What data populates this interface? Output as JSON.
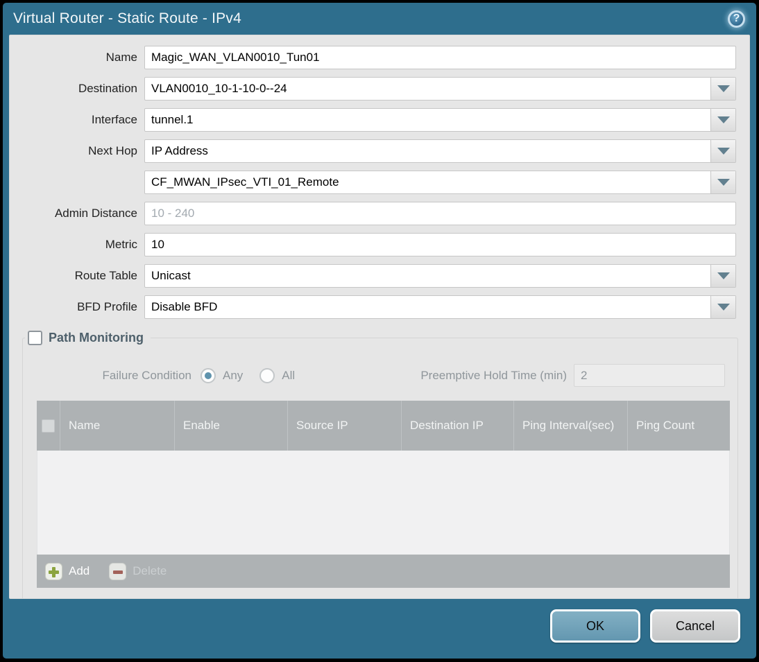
{
  "titlebar": {
    "title": "Virtual Router - Static Route - IPv4"
  },
  "icons": {
    "help": "?"
  },
  "form": {
    "rows": [
      {
        "label": "Name",
        "value": "Magic_WAN_VLAN0010_Tun01"
      },
      {
        "label": "Destination",
        "value": "VLAN0010_10-1-10-0--24"
      },
      {
        "label": "Interface",
        "value": "tunnel.1"
      },
      {
        "label": "Next Hop",
        "value": "IP Address"
      },
      {
        "label": "",
        "value": "CF_MWAN_IPsec_VTI_01_Remote"
      },
      {
        "label": "Admin Distance",
        "value": "",
        "placeholder": "10 - 240"
      },
      {
        "label": "Metric",
        "value": "10"
      },
      {
        "label": "Route Table",
        "value": "Unicast"
      },
      {
        "label": "BFD Profile",
        "value": "Disable BFD"
      }
    ]
  },
  "path_monitoring": {
    "title": "Path Monitoring",
    "checked": false,
    "failure_condition_label": "Failure Condition",
    "radio_any_label": "Any",
    "radio_all_label": "All",
    "radio_selected": "Any",
    "preemptive_label": "Preemptive Hold Time (min)",
    "preemptive_value": "2",
    "table": {
      "columns": [
        "Name",
        "Enable",
        "Source IP",
        "Destination IP",
        "Ping Interval(sec)",
        "Ping Count"
      ],
      "rows": []
    },
    "add_label": "Add",
    "delete_label": "Delete"
  },
  "footer": {
    "ok": "OK",
    "cancel": "Cancel"
  },
  "colors": {
    "frame": "#2e6e8d",
    "content_bg": "#e6e6e6",
    "table_header_bg": "#aeb2b4",
    "ok_button": "#74a6bd",
    "add_green": "#8ba43e",
    "delete_red": "#a3625a",
    "pm_title": "#4e606b"
  }
}
